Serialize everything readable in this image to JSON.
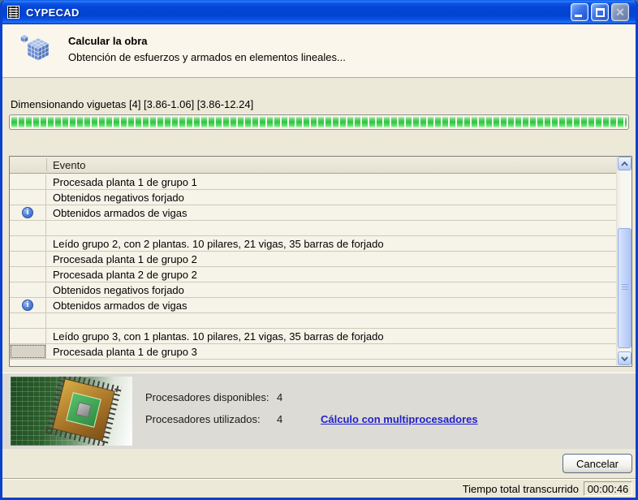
{
  "window": {
    "title": "CYPECAD"
  },
  "header": {
    "title": "Calcular la obra",
    "subtitle": "Obtención de esfuerzos y armados en elementos lineales..."
  },
  "progress": {
    "label": "Dimensionando viguetas [4] [3.86-1.06] [3.86-12.24]",
    "percent": 100
  },
  "table": {
    "header_label": "Evento",
    "rows": [
      {
        "icon": "",
        "text": "Procesada planta 1 de grupo 1"
      },
      {
        "icon": "",
        "text": "Obtenidos negativos forjado"
      },
      {
        "icon": "info",
        "text": "Obtenidos armados de vigas"
      },
      {
        "icon": "",
        "text": ""
      },
      {
        "icon": "",
        "text": "Leído grupo 2, con 2 plantas. 10 pilares, 21 vigas, 35 barras de forjado"
      },
      {
        "icon": "",
        "text": "Procesada planta 1 de grupo 2"
      },
      {
        "icon": "",
        "text": "Procesada planta 2 de grupo 2"
      },
      {
        "icon": "",
        "text": "Obtenidos negativos forjado"
      },
      {
        "icon": "info",
        "text": "Obtenidos armados de vigas"
      },
      {
        "icon": "",
        "text": ""
      },
      {
        "icon": "",
        "text": "Leído grupo 3, con 1 plantas. 10 pilares, 21 vigas, 35 barras de forjado"
      },
      {
        "icon": "",
        "text": "Procesada planta 1 de grupo 3",
        "focused": true
      }
    ]
  },
  "processors": {
    "available_label": "Procesadores disponibles:",
    "available_value": "4",
    "used_label": "Procesadores utilizados:",
    "used_value": "4",
    "link_label": "Cálculo con multiprocesadores"
  },
  "buttons": {
    "cancel_label": "Cancelar"
  },
  "statusbar": {
    "label": "Tiempo total transcurrido",
    "time": "00:00:46"
  },
  "icons": {
    "title": "cypecad-logo",
    "header": "blue-cube-icon",
    "row": "info-icon",
    "image": "cpu-chip-photo"
  },
  "colors": {
    "titlebar_blue": "#0345D4",
    "window_border": "#0B41CC",
    "client_beige": "#ECE9D8",
    "header_cream": "#FAF6EB",
    "progress_green": "#2FC244",
    "table_bg": "#F6F3E8",
    "info_panel_gray": "#DCDBD5",
    "link_blue": "#2222CC"
  }
}
